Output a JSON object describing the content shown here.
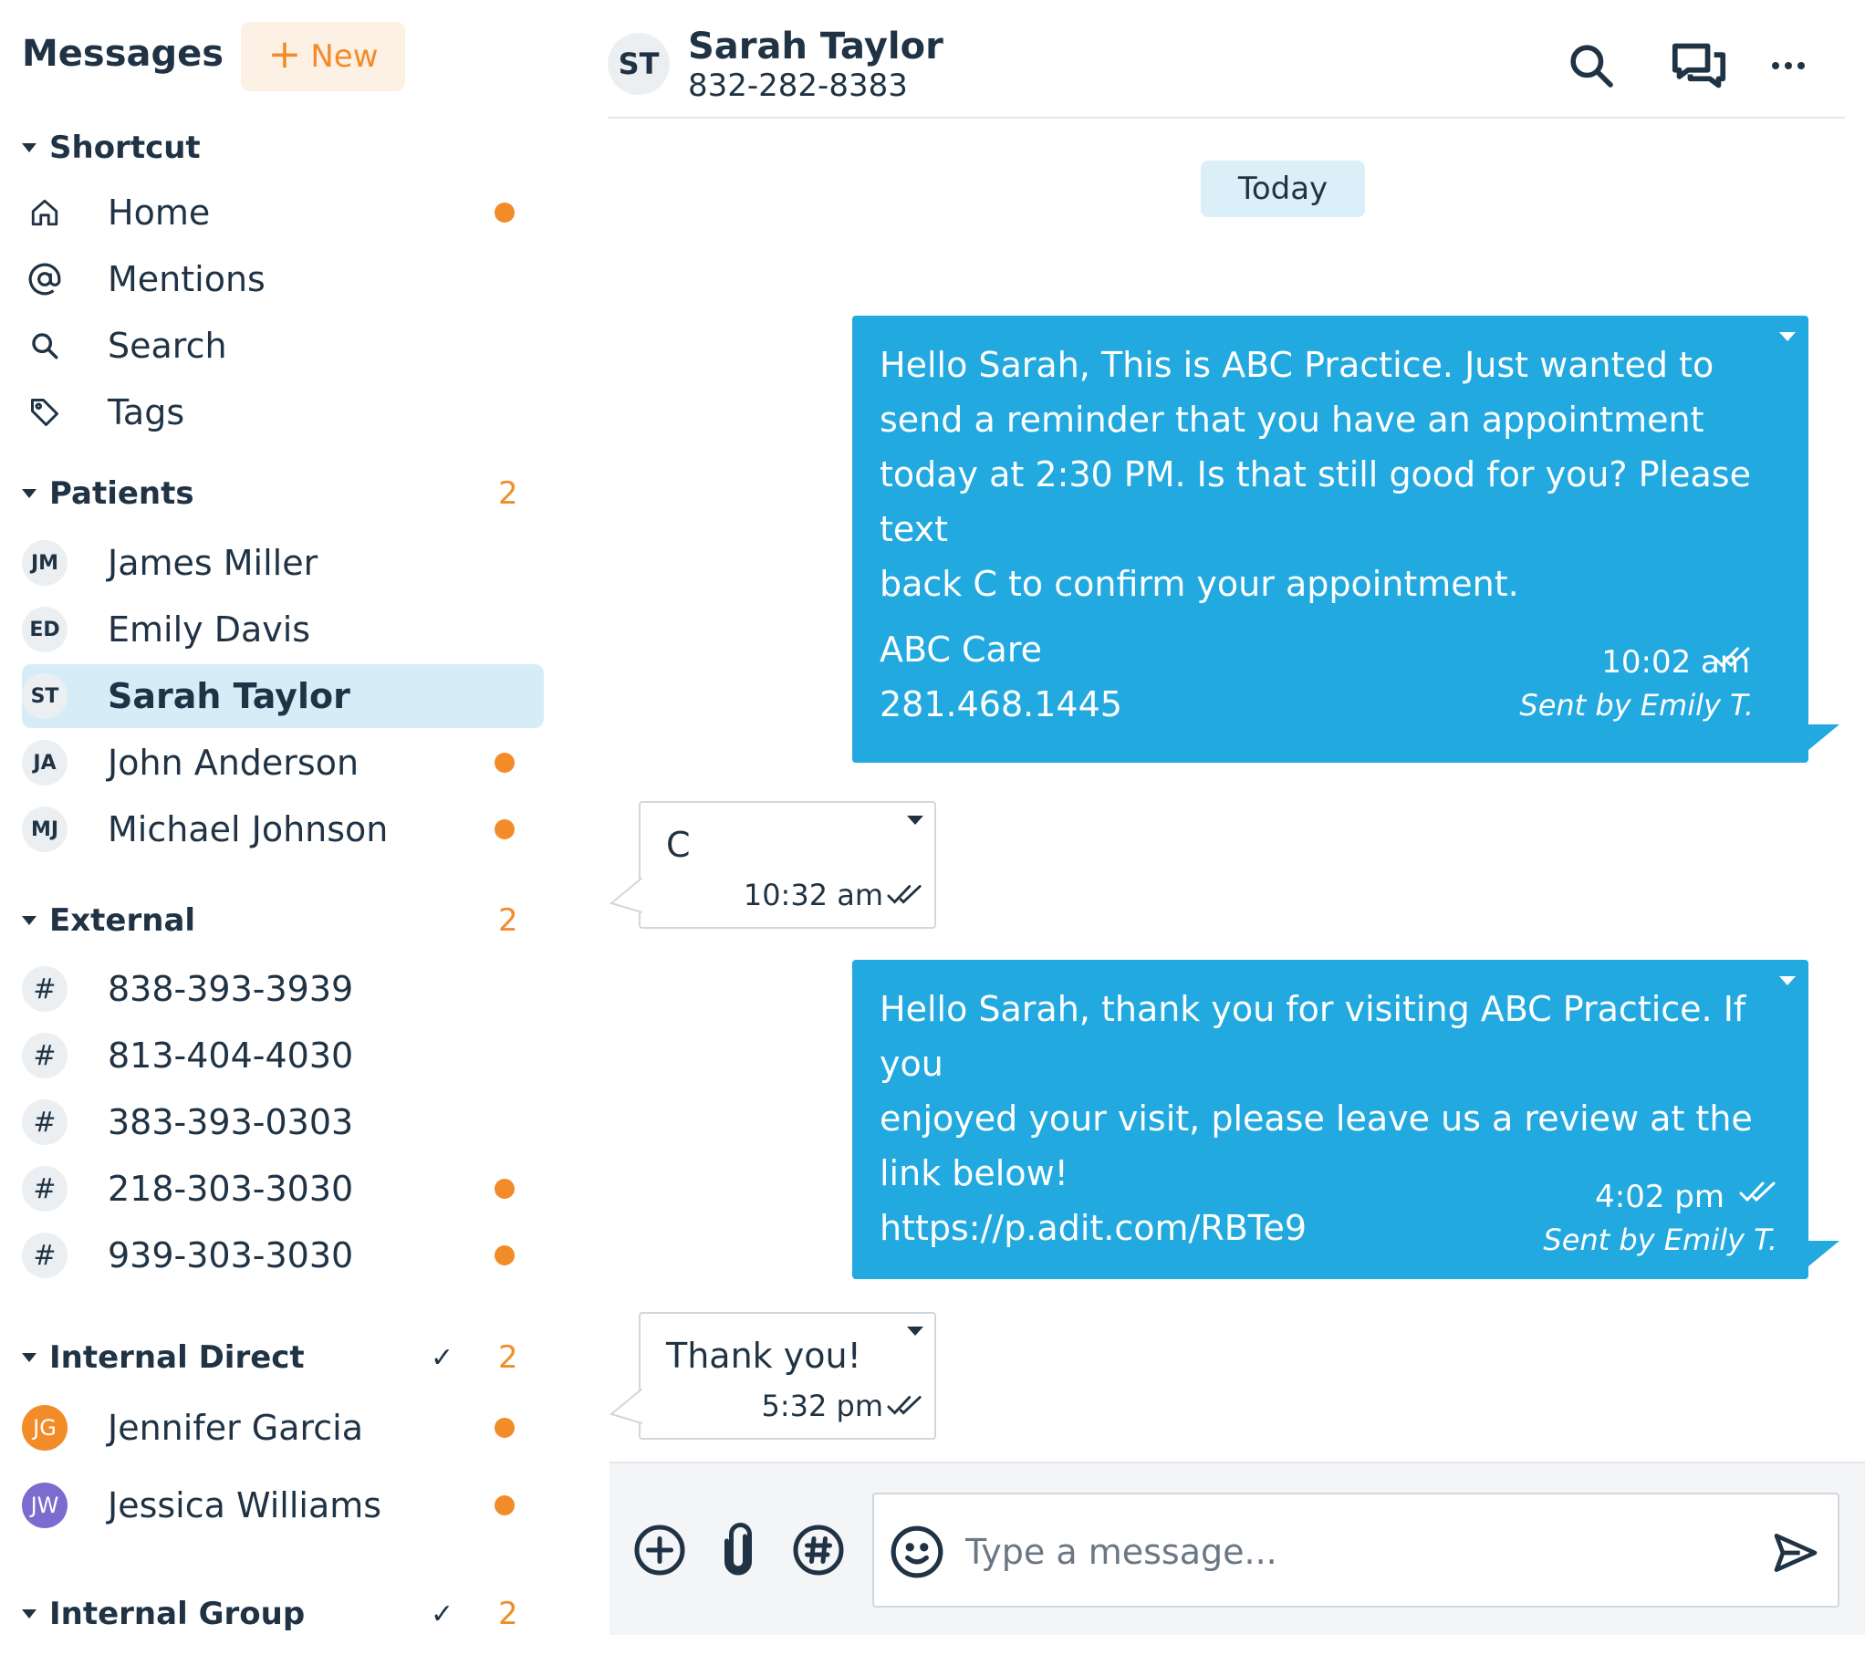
{
  "sidebar": {
    "title": "Messages",
    "new_label": "New",
    "sections": {
      "shortcut": {
        "label": "Shortcut",
        "items": [
          "Home",
          "Mentions",
          "Search",
          "Tags"
        ]
      },
      "patients": {
        "label": "Patients",
        "count": "2",
        "items": [
          {
            "initials": "JM",
            "name": "James Miller",
            "unread": false
          },
          {
            "initials": "ED",
            "name": "Emily Davis",
            "unread": false
          },
          {
            "initials": "ST",
            "name": "Sarah Taylor",
            "unread": false,
            "selected": true
          },
          {
            "initials": "JA",
            "name": "John Anderson",
            "unread": true
          },
          {
            "initials": "MJ",
            "name": "Michael Johnson",
            "unread": true
          }
        ]
      },
      "external": {
        "label": "External",
        "count": "2",
        "items": [
          {
            "symbol": "#",
            "number": "838-393-3939",
            "unread": false
          },
          {
            "symbol": "#",
            "number": "813-404-4030",
            "unread": false
          },
          {
            "symbol": "#",
            "number": "383-393-0303",
            "unread": false
          },
          {
            "symbol": "#",
            "number": "218-303-3030",
            "unread": true
          },
          {
            "symbol": "#",
            "number": "939-303-3030",
            "unread": true
          }
        ]
      },
      "internal_direct": {
        "label": "Internal Direct",
        "count": "2",
        "check": "✓",
        "items": [
          {
            "initials": "JG",
            "name": "Jennifer Garcia",
            "unread": true
          },
          {
            "initials": "JW",
            "name": "Jessica Williams",
            "unread": true
          }
        ]
      },
      "internal_group": {
        "label": "Internal Group",
        "count": "2",
        "check": "✓"
      }
    }
  },
  "conversation": {
    "contact_initials": "ST",
    "contact_name": "Sarah Taylor",
    "contact_phone": "832-282-8383",
    "date_divider": "Today",
    "messages": [
      {
        "direction": "outgoing",
        "lines": [
          "Hello Sarah, This is ABC Practice. Just wanted to",
          "send a reminder that you have an appointment",
          "today at 2:30 PM. Is that still good for you? Please text",
          "back C to confirm your appointment."
        ],
        "signature_lines": [
          "ABC Care",
          "281.468.1445"
        ],
        "time": "10:02 am",
        "sent_by": "Sent by Emily T."
      },
      {
        "direction": "incoming",
        "text": "C",
        "time": "10:32 am"
      },
      {
        "direction": "outgoing",
        "lines": [
          "Hello Sarah, thank you for visiting ABC Practice. If you",
          "enjoyed your visit, please leave us a review at the",
          "link below!",
          "https://p.adit.com/RBTe9"
        ],
        "time": "4:02 pm",
        "sent_by": "Sent by Emily T."
      },
      {
        "direction": "incoming",
        "text": "Thank you!",
        "time": "5:32 pm"
      }
    ],
    "composer": {
      "placeholder": "Type a message..."
    }
  },
  "colors": {
    "accent_orange": "#f28c28",
    "bubble_blue": "#22a9e0",
    "selected_bg": "#d6edf8",
    "text_dark": "#1f3345"
  },
  "icons": [
    "home-icon",
    "at-icon",
    "search-icon",
    "tag-icon",
    "chat-icon",
    "more-icon",
    "plus-circle-icon",
    "paperclip-icon",
    "hash-icon",
    "emoji-icon",
    "send-icon",
    "double-check-icon"
  ]
}
